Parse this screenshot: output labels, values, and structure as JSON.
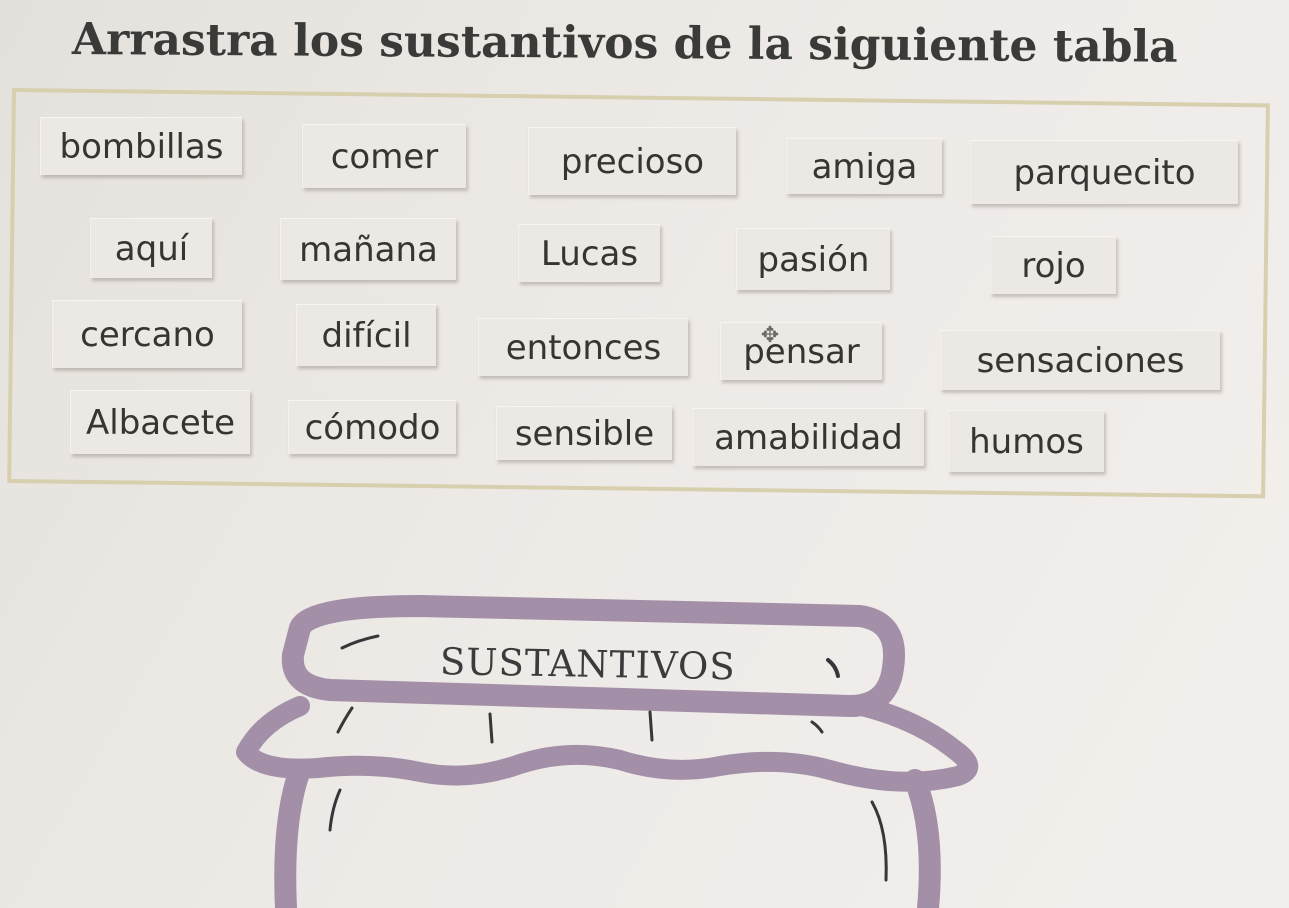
{
  "instruction": "Arrastra los sustantivos de la siguiente tabla",
  "tiles": [
    "bombillas",
    "comer",
    "precioso",
    "amiga",
    "parquecito",
    "aquí",
    "mañana",
    "Lucas",
    "pasión",
    "rojo",
    "cercano",
    "difícil",
    "entonces",
    "pensar",
    "sensaciones",
    "Albacete",
    "cómodo",
    "sensible",
    "amabilidad",
    "humos"
  ],
  "drag_cursor_icon": "move-arrows-icon",
  "drop_target": {
    "label": "SUSTANTIVOS",
    "icon": "jar-icon"
  },
  "colors": {
    "background": "#ece8e4",
    "box_border": "#d8cfae",
    "tile_bg": "#ece8e3",
    "jar": "#a38fa7"
  }
}
